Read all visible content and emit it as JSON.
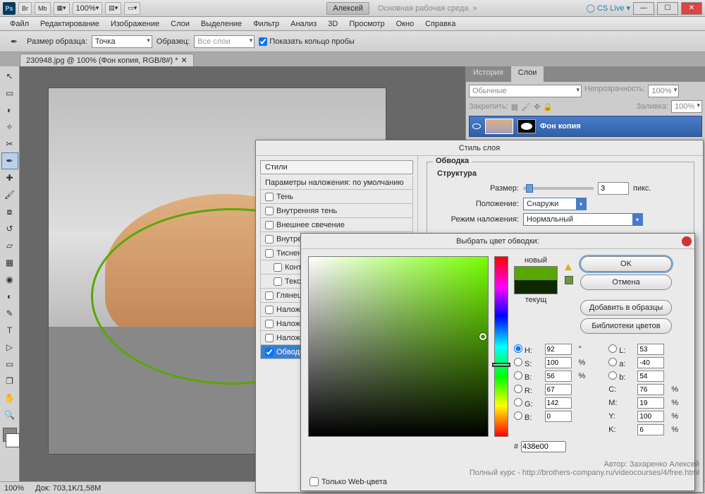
{
  "title_user": "Алексей",
  "workspace_name": "Основная рабочая среда",
  "cs_live": "CS Live",
  "zoom_toolbar": "100%",
  "menu": [
    "Файл",
    "Редактирование",
    "Изображение",
    "Слои",
    "Выделение",
    "Фильтр",
    "Анализ",
    "3D",
    "Просмотр",
    "Окно",
    "Справка"
  ],
  "options": {
    "sample_label": "Размер образца:",
    "sample_value": "Точка",
    "sample2_label": "Образец:",
    "sample2_value": "Все слои",
    "ring_label": "Показать кольцо пробы"
  },
  "doc_tab": "230948.jpg @ 100% (Фон копия, RGB/8#) *",
  "panels": {
    "history_tab": "История",
    "layers_tab": "Слои",
    "blend_mode": "Обычные",
    "opacity_label": "Непрозрачность:",
    "opacity_val": "100%",
    "lock_label": "Закрепить:",
    "fill_label": "Заливка:",
    "fill_val": "100%",
    "layer_name": "Фон копия"
  },
  "layer_style": {
    "title": "Стиль слоя",
    "styles": "Стили",
    "defaults": "Параметры наложения: по умолчанию",
    "items": [
      "Тень",
      "Внутренняя тень",
      "Внешнее свечение",
      "Внутреннее свечение",
      "Тиснение",
      "Контур",
      "Текстура",
      "Глянец",
      "Наложение цвета",
      "Наложение градиента",
      "Наложение узора",
      "Обводка"
    ],
    "section": "Обводка",
    "structure": "Структура",
    "size": "Размер:",
    "size_val": "3",
    "px": "пикс.",
    "position": "Положение:",
    "position_val": "Снаружи",
    "blend": "Режим наложения:",
    "blend_val": "Нормальный"
  },
  "color_picker": {
    "title": "Выбрать цвет обводки:",
    "new": "новый",
    "current": "текущ",
    "ok": "OK",
    "cancel": "Отмена",
    "add_swatch": "Добавить в образцы",
    "libraries": "Библиотеки цветов",
    "H": "92",
    "S": "100",
    "Bv": "56",
    "R": "67",
    "G": "142",
    "Bb": "0",
    "L": "53",
    "a": "-40",
    "b": "54",
    "C": "76",
    "M": "19",
    "Y": "100",
    "K": "6",
    "hex": "438e00",
    "web_only": "Только Web-цвета",
    "new_color": "#5aa600",
    "cur_color": "#0e2800"
  },
  "status": {
    "zoom": "100%",
    "doc": "Док: 703,1K/1,58M"
  },
  "watermark1": "Автор: Захаренко Алексей",
  "watermark2": "Полный курс - http://brothers-company.ru/videocourses/4/free.html"
}
